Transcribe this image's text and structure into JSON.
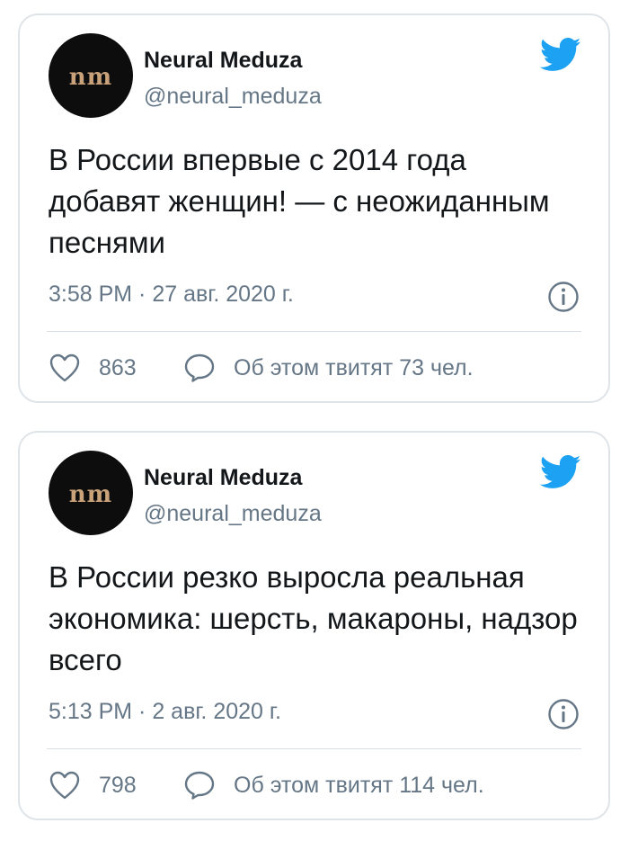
{
  "tweets": [
    {
      "avatar_text": "nm",
      "author_name": "Neural Meduza",
      "author_handle": "@neural_meduza",
      "text": "В России впервые с 2014 года добавят женщин! — с неожиданным песнями",
      "timestamp": "3:58 PM · 27 авг. 2020 г.",
      "likes": "863",
      "replies_text": "Об этом твитят 73 чел."
    },
    {
      "avatar_text": "nm",
      "author_name": "Neural Meduza",
      "author_handle": "@neural_meduza",
      "text": "В России резко выросла реальная экономика: шерсть, макароны, надзор всего",
      "timestamp": "5:13 PM · 2 авг. 2020 г.",
      "likes": "798",
      "replies_text": "Об этом твитят 114 чел."
    }
  ],
  "colors": {
    "twitter_blue": "#1da1f2",
    "secondary_text": "#657786",
    "primary_text": "#14171a",
    "border": "#dfe4e8",
    "avatar_bg": "#0d0d0d",
    "avatar_letters": "#c9a27a"
  },
  "icons": [
    "twitter-bird-icon",
    "info-icon",
    "heart-icon",
    "reply-bubble-icon"
  ]
}
